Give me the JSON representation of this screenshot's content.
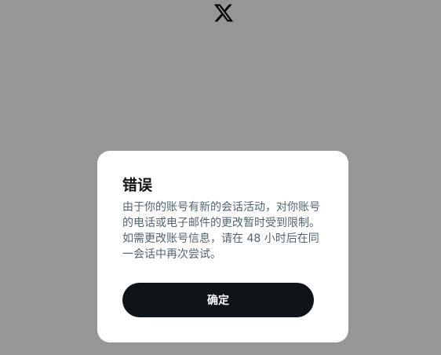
{
  "brand": {
    "logo_icon": "x-logo-icon",
    "logo_color": "#000000"
  },
  "dialog": {
    "title": "错误",
    "message": "由于你的账号有新的会话活动，对你账号的电话或电子邮件的更改暂时受到限制。如需更改账号信息，请在 48 小时后在同一会话中再次尝试。",
    "confirm_label": "确定"
  },
  "colors": {
    "overlay": "#969696",
    "dialog_background": "#ffffff",
    "button_background": "#0f1419",
    "button_text": "#ffffff",
    "title_text": "#0f1419",
    "message_text": "#536471"
  }
}
